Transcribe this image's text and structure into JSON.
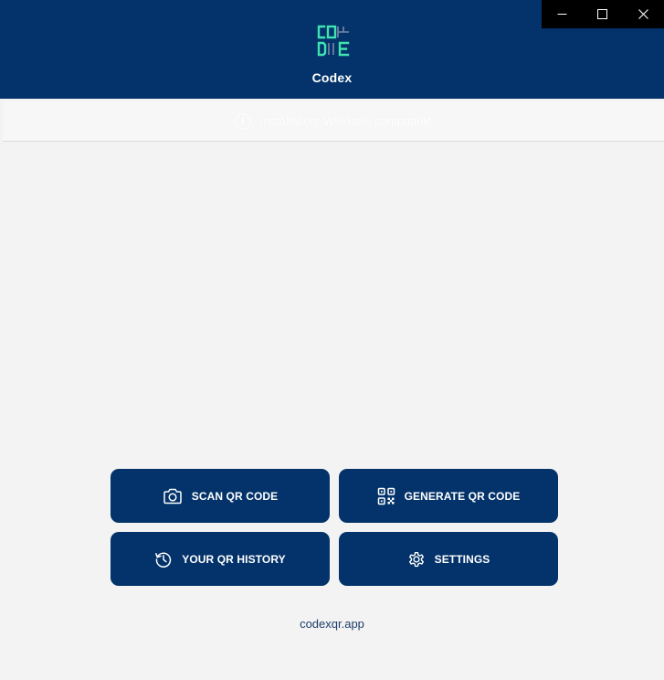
{
  "app": {
    "title": "Codex",
    "logo_icon": "codex-logo-icon",
    "colors": {
      "brand": "#03336a",
      "logo_accent": "#3fe3b0",
      "background": "#f3f3f3"
    }
  },
  "window_controls": {
    "minimize_icon": "minimize-icon",
    "maximize_icon": "maximize-icon",
    "close_icon": "close-icon"
  },
  "notice": {
    "icon": "info-icon",
    "icon_glyph": "i",
    "text": "Installation: Windows compatible"
  },
  "actions": {
    "scan": {
      "label": "SCAN QR CODE",
      "icon": "camera-icon"
    },
    "generate": {
      "label": "GENERATE QR CODE",
      "icon": "qr-code-icon"
    },
    "history": {
      "label": "YOUR QR HISTORY",
      "icon": "history-icon"
    },
    "settings": {
      "label": "SETTINGS",
      "icon": "gear-icon"
    }
  },
  "footer": {
    "link_text": "codexqr.app"
  }
}
